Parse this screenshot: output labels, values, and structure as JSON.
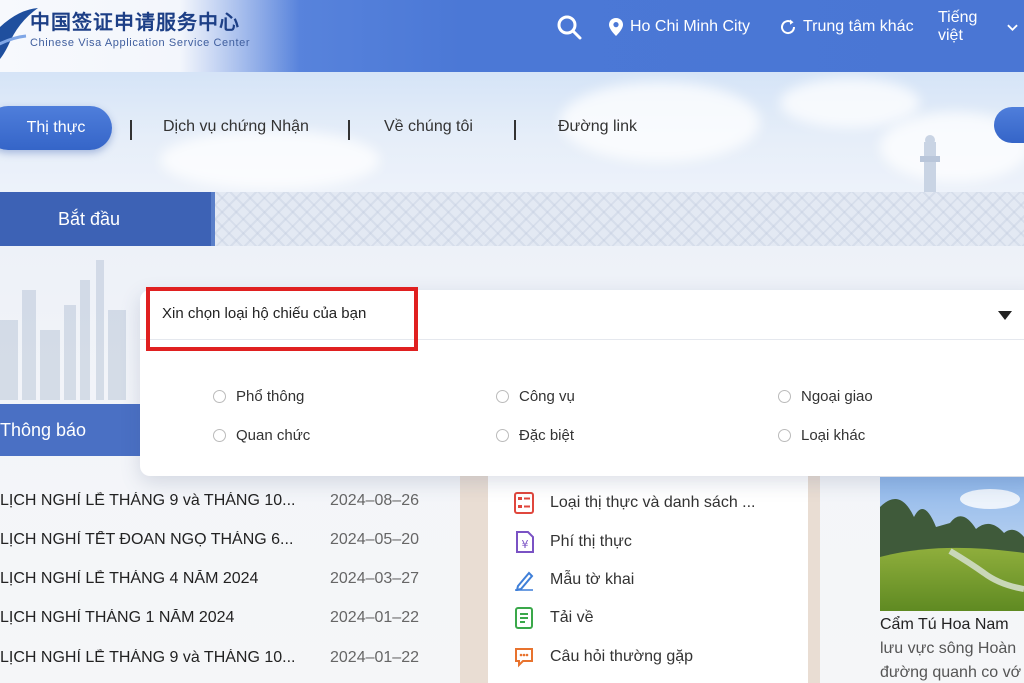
{
  "header": {
    "logo_cn": "中国签证申请服务中心",
    "logo_en": "Chinese Visa Application Service Center",
    "location": "Ho Chi Minh City",
    "other_centers": "Trung tâm khác",
    "language": "Tiếng việt"
  },
  "nav": {
    "items": [
      "Thị thực",
      "Dịch vụ chứng Nhận",
      "Về chúng tôi",
      "Đường link"
    ],
    "separator": "|"
  },
  "start_tab": "Bắt đầu",
  "passport_select": {
    "placeholder": "Xin chọn loại hộ chiếu của bạn",
    "options": [
      "Phổ thông",
      "Công vụ",
      "Ngoại giao",
      "Quan chức",
      "Đặc biệt",
      "Loại khác"
    ]
  },
  "notice_tab": "Thông báo",
  "news": [
    {
      "title": "LỊCH NGHỈ LỄ THÁNG 9 và THÁNG 10...",
      "date": "2024–08–26"
    },
    {
      "title": "LỊCH NGHỈ TẾT ĐOAN NGỌ THÁNG 6...",
      "date": "2024–05–20"
    },
    {
      "title": "LỊCH NGHỈ LỄ THÁNG 4 NĂM 2024",
      "date": "2024–03–27"
    },
    {
      "title": "LỊCH NGHỈ THÁNG 1 NĂM 2024",
      "date": "2024–01–22"
    },
    {
      "title": "LỊCH NGHỈ LỄ THÁNG 9 và THÁNG 10...",
      "date": "2024–01–22"
    }
  ],
  "services": [
    {
      "label": "Loại thị thực và danh sách ...",
      "icon": "list-icon",
      "color": "#e0473d"
    },
    {
      "label": "Phí thị thực",
      "icon": "yen-icon",
      "color": "#7a52c4"
    },
    {
      "label": "Mẫu tờ khai",
      "icon": "pen-icon",
      "color": "#3f7fd8"
    },
    {
      "label": "Tải về",
      "icon": "document-icon",
      "color": "#3aa84a"
    },
    {
      "label": "Câu hỏi thường gặp",
      "icon": "chat-icon",
      "color": "#e8732e"
    }
  ],
  "photo": {
    "caption": "Cẩm Tú Hoa Nam",
    "desc_line1": "lưu vực sông Hoàn",
    "desc_line2": "đường quanh co vớ"
  },
  "colors": {
    "header_blue": "#4b78d6",
    "tab_blue": "#3d62b5",
    "highlight_red": "#e02020"
  }
}
